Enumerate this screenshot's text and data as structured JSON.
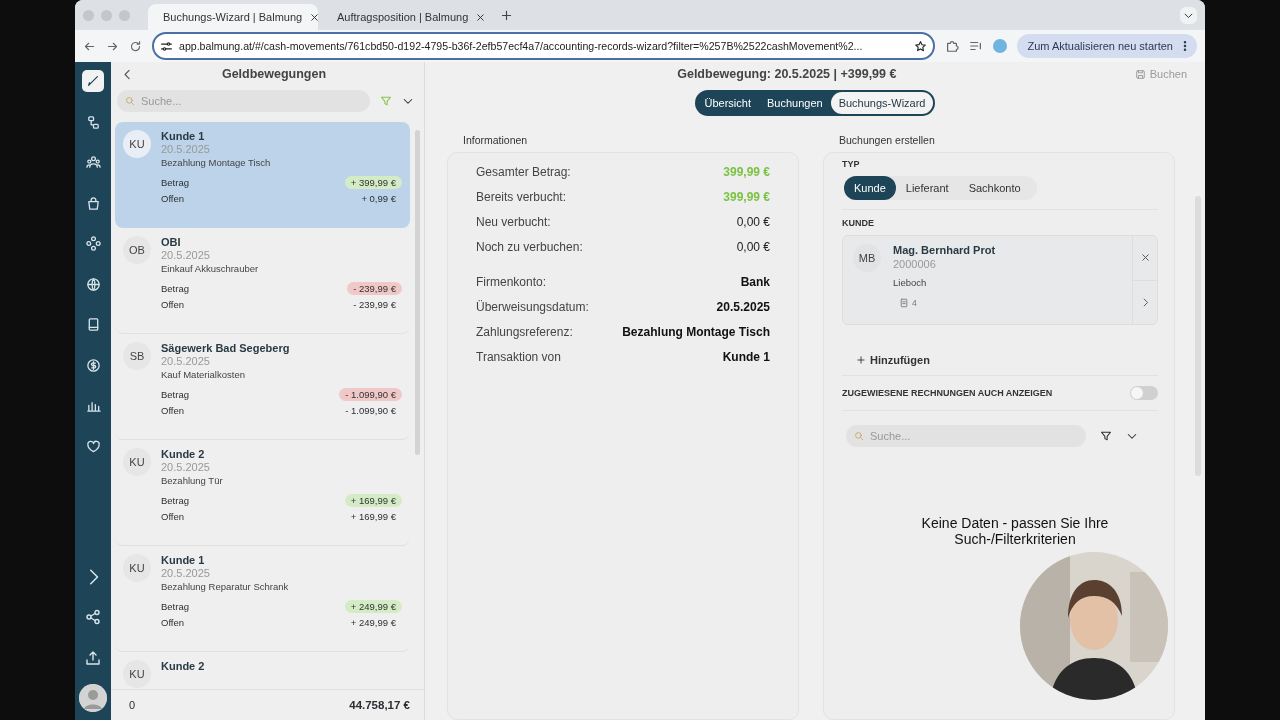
{
  "browser": {
    "tabs": [
      {
        "title": "Buchungs-Wizard | Balmung",
        "selected": true
      },
      {
        "title": "Auftragsposition | Balmung",
        "selected": false
      }
    ],
    "url": "app.balmung.at/#/cash-movements/761cbd50-d192-4795-b36f-2efb57ecf4a7/accounting-records-wizard?filter=%257B%2522cashMovement%2...",
    "update_button": "Zum Aktualisieren neu starten"
  },
  "list_panel": {
    "title": "Geldbewegungen",
    "search": {
      "placeholder": "Suche..."
    },
    "items": [
      {
        "initials": "KU",
        "name": "Kunde 1",
        "date": "20.5.2025",
        "description": "Bezahlung Montage Tisch",
        "amount_label": "Betrag",
        "amount": "+ 399,99 €",
        "color": "#d4ecc6",
        "open_label": "Offen",
        "open": "+ 0,99 €",
        "selected": true
      },
      {
        "initials": "OB",
        "name": "OBI",
        "date": "20.5.2025",
        "description": "Einkauf Akkuschrauber",
        "amount_label": "Betrag",
        "amount": "- 239,99 €",
        "color": "#f0c8c8",
        "open_label": "Offen",
        "open": "- 239,99 €",
        "selected": false
      },
      {
        "initials": "SB",
        "name": "Sägewerk Bad Segeberg",
        "date": "20.5.2025",
        "description": "Kauf Materialkosten",
        "amount_label": "Betrag",
        "amount": "- 1.099,90 €",
        "color": "#f0c8c8",
        "open_label": "Offen",
        "open": "- 1.099,90 €",
        "selected": false
      },
      {
        "initials": "KU",
        "name": "Kunde 2",
        "date": "20.5.2025",
        "description": "Bezahlung Tür",
        "amount_label": "Betrag",
        "amount": "+ 169,99 €",
        "color": "#d4ecc6",
        "open_label": "Offen",
        "open": "+ 169,99 €",
        "selected": false
      },
      {
        "initials": "KU",
        "name": "Kunde 1",
        "date": "20.5.2025",
        "description": "Bezahlung Reparatur Schrank",
        "amount_label": "Betrag",
        "amount": "+ 249,99 €",
        "color": "#d4ecc6",
        "open_label": "Offen",
        "open": "+ 249,99 €",
        "selected": false
      },
      {
        "initials": "KU",
        "name": "Kunde 2",
        "selected": false
      }
    ],
    "footer": {
      "count": "0",
      "total": "44.758,17 €"
    }
  },
  "main": {
    "title": "Geldbewegung: 20.5.2025 | +399,99 €",
    "save_button": {
      "label": "Buchen",
      "disabled": true
    },
    "tabs": [
      {
        "label": "Übersicht",
        "selected": false
      },
      {
        "label": "Buchungen",
        "selected": false
      },
      {
        "label": "Buchungs-Wizard",
        "selected": true
      }
    ],
    "info": {
      "title": "Informationen",
      "groups": [
        [
          {
            "label": "Gesamter Betrag:",
            "value": "399,99 €",
            "color": "#7cc242",
            "bold": true
          },
          {
            "label": "Bereits verbucht:",
            "value": "399,99 €",
            "color": "#7cc242",
            "bold": true
          },
          {
            "label": "Neu verbucht:",
            "value": "0,00 €",
            "color": "#222222",
            "bold": false
          },
          {
            "label": "Noch zu verbuchen:",
            "value": "0,00 €",
            "color": "#222222",
            "bold": false
          }
        ],
        [
          {
            "label": "Firmenkonto:",
            "value": "Bank",
            "color": "#111111",
            "bold": true
          },
          {
            "label": "Überweisungsdatum:",
            "value": "20.5.2025",
            "color": "#111111",
            "bold": true
          },
          {
            "label": "Zahlungsreferenz:",
            "value": "Bezahlung Montage Tisch",
            "color": "#111111",
            "bold": true
          },
          {
            "label": "Transaktion von",
            "value": "Kunde 1",
            "color": "#111111",
            "bold": true
          }
        ]
      ]
    },
    "booking": {
      "title": "Buchungen erstellen",
      "type_label": "TYP",
      "types": [
        {
          "label": "Kunde",
          "selected": true
        },
        {
          "label": "Lieferant",
          "selected": false
        },
        {
          "label": "Sachkonto",
          "selected": false
        }
      ],
      "customer_label": "KUNDE",
      "customer": {
        "initials": "MB",
        "name": "Mag. Bernhard Prot",
        "number": "2000006",
        "city": "Lieboch",
        "documents": "4"
      },
      "add_button": "Hinzufügen",
      "toggle": {
        "label": "ZUGEWIESENE RECHNUNGEN AUCH ANZEIGEN",
        "on": false
      },
      "search": {
        "placeholder": "Suche..."
      },
      "empty_message": "Keine Daten - passen Sie Ihre Such-/Filterkriterien"
    }
  }
}
